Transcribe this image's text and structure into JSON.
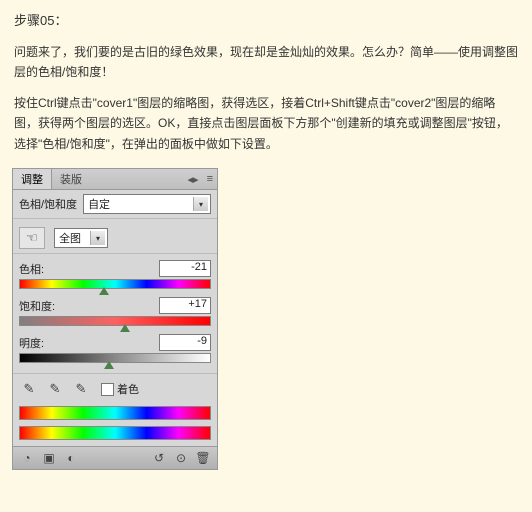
{
  "article": {
    "step_title": "步骤05：",
    "para1": "问题来了，我们要的是古旧的绿色效果，现在却是金灿灿的效果。怎么办？简单——使用调整图层的色相/饱和度！",
    "para2": "按住Ctrl键点击\"cover1\"图层的缩略图，获得选区，接着Ctrl+Shift键点击\"cover2\"图层的缩略图，获得两个图层的选区。OK，直接点击图层面板下方那个\"创建新的填充或调整图层\"按钮，选择\"色相/饱和度\"，在弹出的面板中做如下设置。"
  },
  "panel": {
    "tabs": {
      "active": "调整",
      "inactive": "装版"
    },
    "preset": {
      "label": "色相/饱和度",
      "value": "自定"
    },
    "range_select": "全图",
    "sliders": {
      "hue": {
        "label": "色相:",
        "value": "-21",
        "pos_pct": 44
      },
      "sat": {
        "label": "饱和度:",
        "value": "+17",
        "pos_pct": 55
      },
      "light": {
        "label": "明度:",
        "value": "-9",
        "pos_pct": 47
      }
    },
    "colorize_label": "着色"
  },
  "icons": {
    "hand": "☜",
    "eyedrop": "✎",
    "menu": "≡"
  }
}
